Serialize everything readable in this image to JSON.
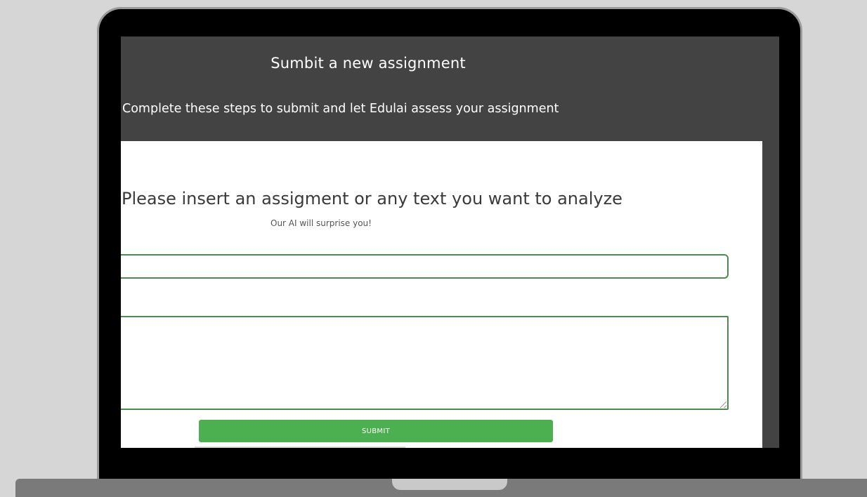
{
  "screen": {
    "title": "Sumbit a new assignment",
    "subtitle": "Complete these steps to submit and let Edulai assess your assignment"
  },
  "form": {
    "heading": "Please insert an assigment or any text you want to analyze",
    "tagline": "Our AI will surprise you!",
    "title_input_value": "",
    "text_area_value": "",
    "submit_label": "SUBMIT"
  },
  "colors": {
    "header_background": "#434343",
    "card_background": "#ffffff",
    "field_border": "#4e8a4e",
    "submit_button": "#4caf50",
    "laptop_frame": "#000000",
    "backdrop": "#d6d6d6"
  }
}
